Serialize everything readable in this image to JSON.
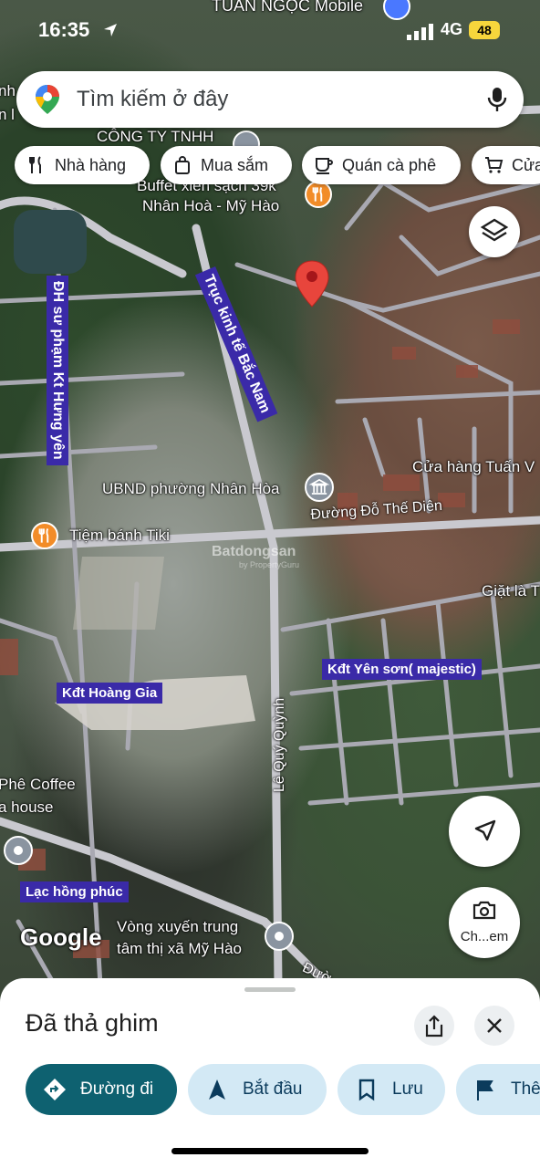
{
  "status_bar": {
    "time": "16:35",
    "network": "4G",
    "battery": "48",
    "top_label": "TUẤN NGỌC Mobile"
  },
  "search": {
    "placeholder": "Tìm kiếm ở đây"
  },
  "chips": [
    {
      "label": "Nhà hàng",
      "icon": "restaurant-icon"
    },
    {
      "label": "Mua sắm",
      "icon": "shopping-bag-icon"
    },
    {
      "label": "Quán cà phê",
      "icon": "coffee-icon"
    },
    {
      "label": "Cửa",
      "icon": "cart-icon"
    }
  ],
  "map": {
    "labels": {
      "company": "CÔNG TY TNHH",
      "buffet": "Buffet xiên sạch 39k",
      "buffet_area": "Nhân Hoà - Mỹ Hào",
      "ubnd": "UBND phường Nhân Hòa",
      "shop_tuan": "Cửa hàng Tuấn V",
      "tiem_banh": "Tiệm bánh Tiki",
      "giat_la": "Giặt là T",
      "phe_coffee": "Phê Coffee",
      "a_house": "a house",
      "vong_xuyen_1": "Vòng xuyến trung",
      "vong_xuyen_2": "tâm thị xã Mỹ Hào",
      "partial_left_1": "nh",
      "partial_left_2": "n l",
      "google": "Google",
      "watermark": "Batdongsan",
      "watermark_sub": "by PropertyGuru",
      "partial_bottom_road": "Đườ"
    },
    "roads": {
      "truc_kinh_te": "Trục kinh tế Bắc Nam",
      "dh_su_pham": "ĐH sư phạm Kt Hưng yên",
      "do_the_dien": "Đường Đỗ Thế Diên",
      "le_quy_quynh": "Lê Quý Quỳnh"
    },
    "areas": {
      "hoang_gia": "Kđt Hoàng Gia",
      "yen_son": "Kđt Yên sơn( majestic)",
      "lac_hong": "Lạc hồng phúc"
    },
    "camera_button_label": "Ch...em"
  },
  "sheet": {
    "title": "Đã thả ghim",
    "actions": [
      {
        "label": "Đường đi",
        "icon": "directions-icon"
      },
      {
        "label": "Bắt đầu",
        "icon": "navigation-arrow-icon"
      },
      {
        "label": "Lưu",
        "icon": "bookmark-icon"
      },
      {
        "label": "Thê",
        "icon": "flag-icon"
      }
    ]
  },
  "colors": {
    "primary_action": "#0e6170",
    "secondary_action": "#d3e9f5",
    "pin": "#e8453c",
    "tag_purple": "#3a2aa8"
  }
}
